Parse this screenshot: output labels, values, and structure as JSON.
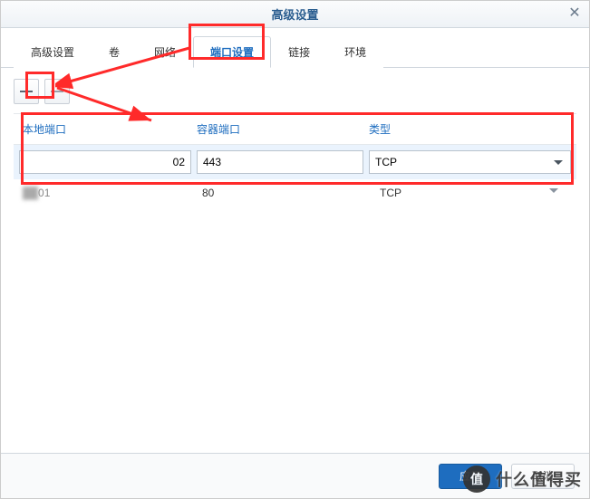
{
  "title": "高级设置",
  "tabs": {
    "advanced": "高级设置",
    "volume": "卷",
    "network": "网络",
    "ports": "端口设置",
    "link": "链接",
    "env": "环境"
  },
  "active_tab": "ports",
  "headers": {
    "local": "本地端口",
    "container": "容器端口",
    "type": "类型"
  },
  "rows": [
    {
      "local": "02",
      "container": "443",
      "type": "TCP",
      "selected": true
    },
    {
      "local": "01",
      "container": "80",
      "type": "TCP",
      "selected": false
    }
  ],
  "buttons": {
    "ok": "应用",
    "cancel": "取消"
  },
  "watermark": {
    "icon": "值",
    "text": "什么值得买"
  }
}
